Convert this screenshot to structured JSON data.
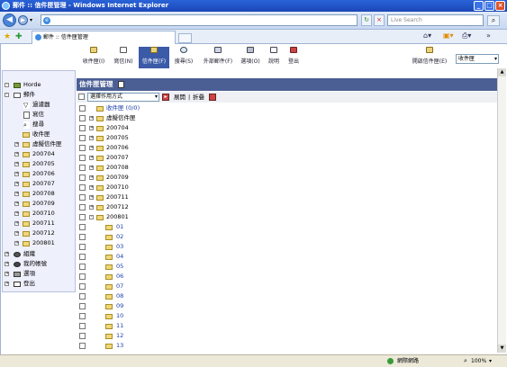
{
  "window": {
    "title": "郵件 :: 信件匣管理 - Windows Internet Explorer",
    "tab_title": "郵件 :: 信件匣管理",
    "search_placeholder": "Live Search",
    "zoom": "100%",
    "zone": "網際網路"
  },
  "menu": {
    "items": [
      {
        "label": "收件匣(I)",
        "selected": false
      },
      {
        "label": "寫信(N)",
        "selected": false
      },
      {
        "label": "信件匣(F)",
        "selected": true
      },
      {
        "label": "搜尋(S)",
        "selected": false
      },
      {
        "label": "外部郵件(F)",
        "selected": false
      },
      {
        "label": "選項(O)",
        "selected": false
      },
      {
        "label": "說明",
        "selected": false
      },
      {
        "label": "登出",
        "selected": false
      }
    ],
    "open_folder_label": "開啟信件匣(E)",
    "folder_select": "收件匣"
  },
  "sidebar": {
    "items": [
      {
        "label": "Horde"
      },
      {
        "label": "郵件"
      },
      {
        "label": "過濾器"
      },
      {
        "label": "寫信"
      },
      {
        "label": "搜尋"
      },
      {
        "label": "收件匣"
      },
      {
        "label": "虛擬信件匣"
      },
      {
        "label": "200704"
      },
      {
        "label": "200705"
      },
      {
        "label": "200706"
      },
      {
        "label": "200707"
      },
      {
        "label": "200708"
      },
      {
        "label": "200709"
      },
      {
        "label": "200710"
      },
      {
        "label": "200711"
      },
      {
        "label": "200712"
      },
      {
        "label": "200801"
      },
      {
        "label": "組織"
      },
      {
        "label": "我的帳號"
      },
      {
        "label": "選項"
      },
      {
        "label": "登出"
      }
    ]
  },
  "main": {
    "title": "信件匣管理",
    "action_select": "選擇作用方式",
    "expand_label": "展開",
    "collapse_label": "折疊",
    "separator": "|",
    "folders": [
      {
        "label": "收件匣 (0/0)"
      },
      {
        "label": "虛擬信件匣"
      },
      {
        "label": "200704"
      },
      {
        "label": "200705"
      },
      {
        "label": "200706"
      },
      {
        "label": "200707"
      },
      {
        "label": "200708"
      },
      {
        "label": "200709"
      },
      {
        "label": "200710"
      },
      {
        "label": "200711"
      },
      {
        "label": "200712"
      },
      {
        "label": "200801"
      },
      {
        "label": "01"
      },
      {
        "label": "02"
      },
      {
        "label": "03"
      },
      {
        "label": "04"
      },
      {
        "label": "05"
      },
      {
        "label": "06"
      },
      {
        "label": "07"
      },
      {
        "label": "08"
      },
      {
        "label": "09"
      },
      {
        "label": "10"
      },
      {
        "label": "11"
      },
      {
        "label": "12"
      },
      {
        "label": "13"
      }
    ]
  },
  "colors": {
    "header_bg": "#4b5f95",
    "selected_menu": "#3b5aa8",
    "sidebar_bg": "#eef0fb",
    "link": "#1a3ea8"
  }
}
